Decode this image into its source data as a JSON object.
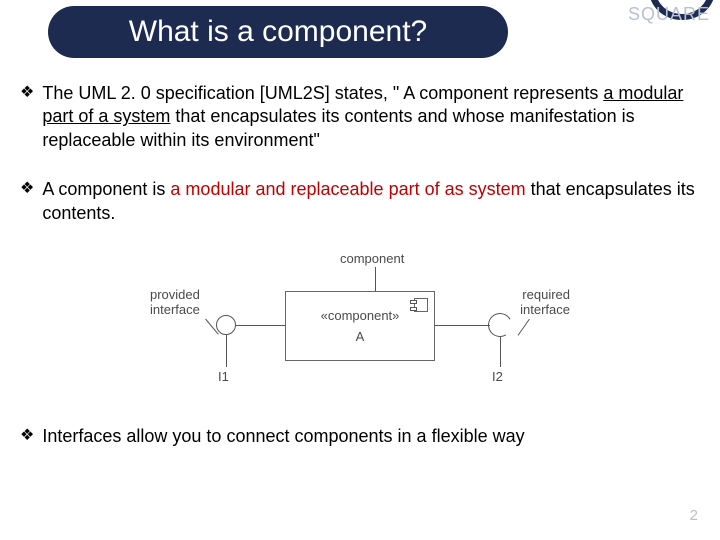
{
  "header": {
    "title": "What is a component?",
    "watermark": "SQUARE"
  },
  "bullets": {
    "b1_pre": "The UML 2. 0 specification [UML2S] states, \" A component represents ",
    "b1_em": "a modular part of a system",
    "b1_post": " that encapsulates its contents and whose manifestation is replaceable within its environment\"",
    "b2_pre": "A component is ",
    "b2_em": "a modular and replaceable part of as system",
    "b2_post": " that encapsulates its contents.",
    "b3": "Interfaces allow you to connect components in a flexible way"
  },
  "diagram": {
    "component_label": "component",
    "provided_label": "provided\ninterface",
    "required_label": "required\ninterface",
    "stereotype": "«component»",
    "name": "A",
    "i1": "I1",
    "i2": "I2"
  },
  "page": "2"
}
